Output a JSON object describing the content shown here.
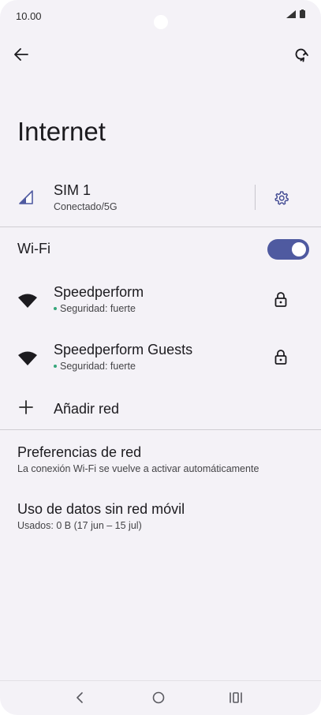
{
  "status_bar": {
    "time": "10.00"
  },
  "header": {
    "title": "Internet"
  },
  "sim": {
    "name": "SIM 1",
    "status": "Conectado/5G"
  },
  "wifi": {
    "label": "Wi-Fi",
    "enabled": true,
    "networks": [
      {
        "name": "Speedperform",
        "security": "Seguridad: fuerte"
      },
      {
        "name": "Speedperform Guests",
        "security": "Seguridad: fuerte"
      }
    ],
    "add_label": "Añadir red"
  },
  "preferences": {
    "title": "Preferencias de red",
    "subtitle": "La conexión Wi-Fi se vuelve a activar automáticamente"
  },
  "data_usage": {
    "title": "Uso de datos sin red móvil",
    "subtitle": "Usados: 0 B (17 jun – 15 jul)"
  },
  "colors": {
    "accent": "#4f5aa0",
    "background": "#f4f2f7",
    "secure_dot": "#35a67a"
  },
  "icons": {
    "back": "arrow-left-icon",
    "sync": "sync-icon",
    "signal": "signal-icon",
    "settings": "gear-icon",
    "wifi": "wifi-icon",
    "lock": "lock-icon",
    "add": "plus-icon"
  }
}
